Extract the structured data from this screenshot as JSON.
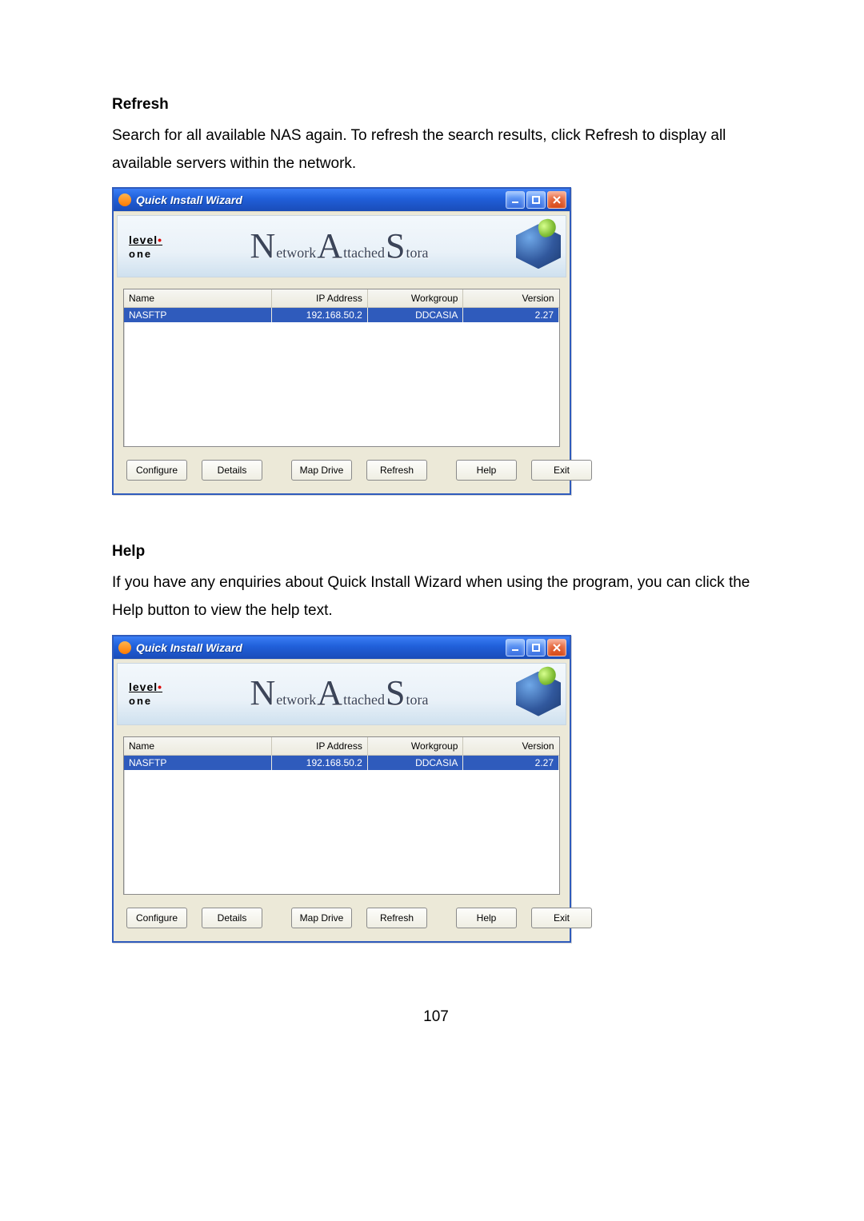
{
  "sections": {
    "refresh": {
      "title": "Refresh",
      "body": "Search for all available NAS again. To refresh the search results, click Refresh to display all available servers within the network."
    },
    "help": {
      "title": "Help",
      "body": "If you have any enquiries about Quick Install Wizard when using the program, you can click the Help button to view the help text."
    }
  },
  "window": {
    "title": "Quick Install Wizard",
    "banner": {
      "logo_top": "level",
      "logo_dot": "•",
      "logo_bottom": "one",
      "nas_n": "N",
      "nas_etwork": "etwork",
      "nas_a": "A",
      "nas_ttached": "ttached",
      "nas_s": "S",
      "nas_tor": "tora"
    },
    "columns": {
      "name": "Name",
      "ip": "IP Address",
      "workgroup": "Workgroup",
      "version": "Version"
    },
    "row": {
      "name": "NASFTP",
      "ip": "192.168.50.2",
      "workgroup": "DDCASIA",
      "version": "2.27"
    },
    "buttons": {
      "configure": "Configure",
      "details": "Details",
      "mapdrive": "Map Drive",
      "refresh": "Refresh",
      "help": "Help",
      "exit": "Exit"
    }
  },
  "page_number": "107"
}
